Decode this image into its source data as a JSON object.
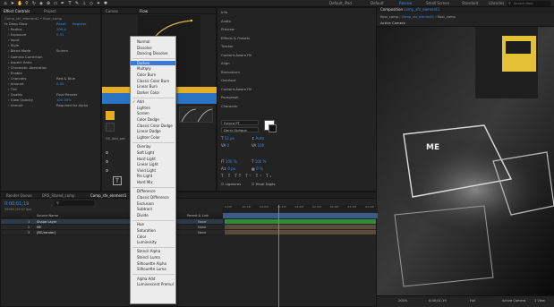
{
  "topbar": {
    "workspaces": [
      "Default_iPad",
      "Default",
      "Review",
      "Small Screen",
      "Standard",
      "Libraries"
    ],
    "active_workspace": "Review",
    "search_placeholder": "Search Help"
  },
  "left_panel": {
    "tabs": [
      "Effect Controls",
      "Project"
    ],
    "active_tab": "Effect Controls",
    "header": "Comp_sfx_element1 • floor_comp",
    "effect_name": "Deep Glow",
    "reset_label": "Reset",
    "register_label": "Register",
    "properties": [
      {
        "name": "Radius",
        "value": "200.0"
      },
      {
        "name": "Exposure",
        "value": "0.31"
      },
      {
        "name": "Input",
        "value": ""
      },
      {
        "name": "Style",
        "value": ""
      },
      {
        "name": "Blend Mode",
        "value": "Screen"
      },
      {
        "name": "Gamma Correction",
        "value": ""
      },
      {
        "name": "Aspect Ratio",
        "value": ""
      },
      {
        "name": "Chromatic Aberration",
        "value": ""
      },
      {
        "name": "Enable",
        "value": ""
      },
      {
        "name": "Channels",
        "value": "Red & Blue"
      },
      {
        "name": "Amount",
        "value": "0.00"
      },
      {
        "name": "Tint",
        "value": ""
      },
      {
        "name": "Quality",
        "value": "Final Render"
      },
      {
        "name": "Glow Opacity",
        "value": "100.00%"
      },
      {
        "name": "Unmult",
        "value": "Required for Alpha"
      }
    ]
  },
  "middle_panel": {
    "tabs": [
      "Flow",
      "Curves"
    ],
    "curve_label": "Light Speed",
    "preset_label": "GS_Add_pen"
  },
  "blend_menu": {
    "groups": [
      [
        "Normal",
        "Dissolve",
        "Dancing Dissolve"
      ],
      [
        "Darken",
        "Multiply",
        "Color Burn",
        "Classic Color Burn",
        "Linear Burn",
        "Darker Color"
      ],
      [
        "Add",
        "Lighten",
        "Screen",
        "Color Dodge",
        "Classic Color Dodge",
        "Linear Dodge",
        "Lighter Color"
      ],
      [
        "Overlay",
        "Soft Light",
        "Hard Light",
        "Linear Light",
        "Vivid Light",
        "Pin Light",
        "Hard Mix"
      ],
      [
        "Difference",
        "Classic Difference",
        "Exclusion",
        "Subtract",
        "Divide"
      ],
      [
        "Hue",
        "Saturation",
        "Color",
        "Luminosity"
      ],
      [
        "Stencil Alpha",
        "Stencil Luma",
        "Silhouette Alpha",
        "Silhouette Luma"
      ],
      [
        "Alpha Add",
        "Luminescent Premul"
      ]
    ],
    "highlighted": "Darken",
    "checked": "Add"
  },
  "right_side_panel": {
    "sections": [
      "Info",
      "Audio",
      "Preview",
      "Effects & Presets",
      "Tracker",
      "Content-Aware Fill",
      "Align",
      "Brainstorm",
      "Overlord",
      "Content-Aware Fill",
      "Paragraph",
      "Character"
    ],
    "font_family": "Futura PT",
    "font_style": "Demi Oblique",
    "font_size": "52 px",
    "leading": "Auto",
    "kerning": "0",
    "tracking": "100",
    "vscale": "100 %",
    "hscale": "100 %",
    "baseline": "0 px",
    "tsume": "0 %",
    "ligatures_label": "Ligatures",
    "hindi_label": "Hindi Digits"
  },
  "viewer": {
    "tab_label": "Composition",
    "comp_name": "comp_sfx_element1",
    "breadcrumbs": [
      "floor_comp",
      "Comp_sfx_element1",
      "floor_comp"
    ],
    "active_camera": "Active Camera",
    "key_label": "ME",
    "zoom": "200%",
    "timecode": "0;00;01;19",
    "resolution": "Full",
    "view_label": "1 View"
  },
  "timeline": {
    "tabs": [
      "Render Queue",
      "DRS_Stored_comp",
      "Comp_sfx_element1",
      "floor_comp"
    ],
    "active_tab": "Comp_sfx_element1",
    "timecode": "0;00;01;19",
    "frame_info": "00049 (29.97 fps)",
    "columns": [
      "Source Name",
      "Parent & Link",
      "Mode"
    ],
    "layers": [
      {
        "num": "1",
        "name": "Shape Layer",
        "mode": "None"
      },
      {
        "num": "2",
        "name": "ME",
        "mode": "None"
      },
      {
        "num": "3",
        "name": "[BG/render]",
        "mode": "None"
      }
    ],
    "ruler_ticks": [
      "0:00f",
      "00:15f",
      "01:00f",
      "01:15f",
      "02:00f",
      "02:15f",
      "03:00f",
      "03:15f",
      "04:00f"
    ],
    "playhead_fraction": 0.36
  },
  "colors": {
    "accent": "#3b79d4",
    "workspace_active": "#3c8fe8",
    "layer_green": "#2f8a3a",
    "layer_brown": "#5a4a3a",
    "yellow_label": "#e6b52f"
  }
}
